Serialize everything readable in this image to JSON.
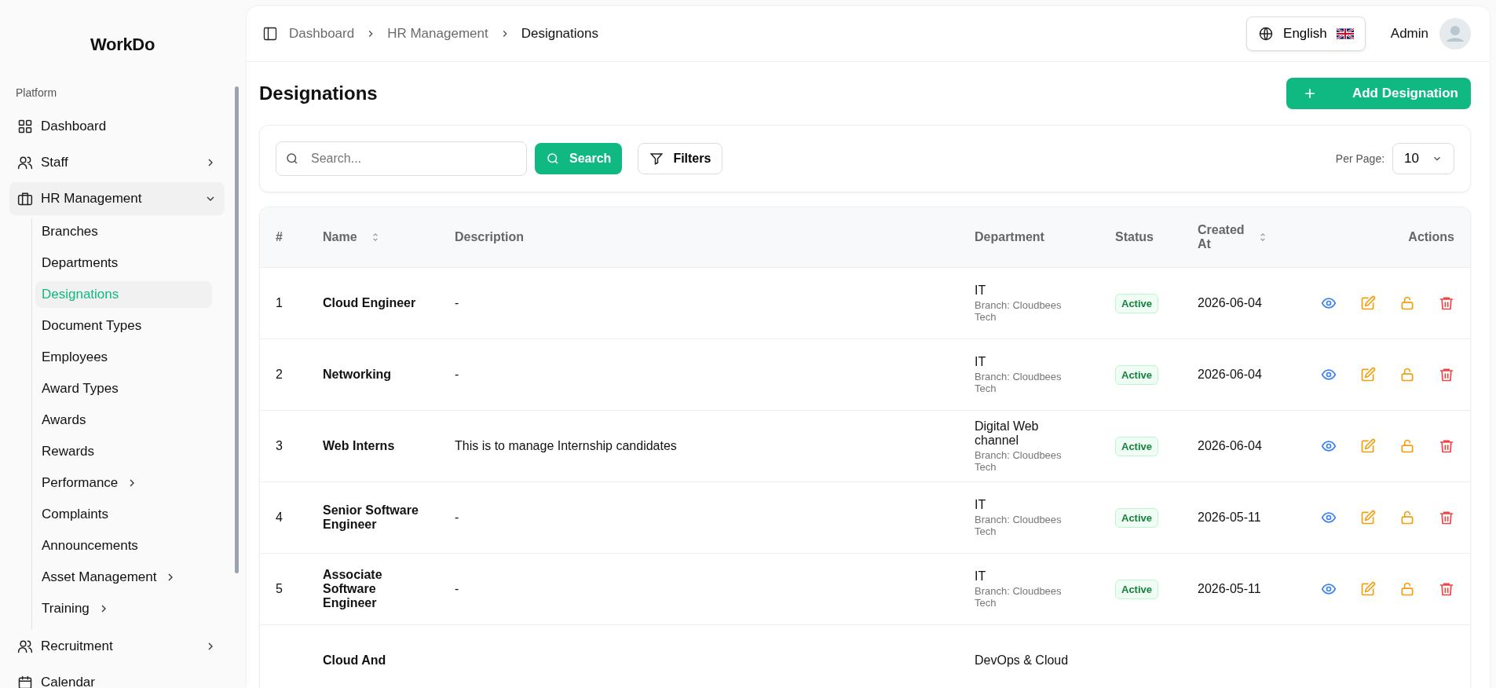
{
  "sidebar": {
    "brand": "WorkDo",
    "section": "Platform",
    "items": [
      {
        "label": "Dashboard",
        "selected": false
      },
      {
        "label": "Staff",
        "selected": false,
        "expanded": false
      },
      {
        "label": "HR Management",
        "selected": false,
        "expanded": true,
        "children": [
          {
            "label": "Branches",
            "selected": false
          },
          {
            "label": "Departments",
            "selected": false
          },
          {
            "label": "Designations",
            "selected": true
          },
          {
            "label": "Document Types",
            "selected": false
          },
          {
            "label": "Employees",
            "selected": false
          },
          {
            "label": "Award Types",
            "selected": false
          },
          {
            "label": "Awards",
            "selected": false
          },
          {
            "label": "Rewards",
            "selected": false
          },
          {
            "label": "Performance",
            "selected": false,
            "expanded": false
          },
          {
            "label": "Complaints",
            "selected": false
          },
          {
            "label": "Announcements",
            "selected": false
          },
          {
            "label": "Asset Management",
            "selected": false,
            "expanded": false
          },
          {
            "label": "Training",
            "selected": false,
            "expanded": false
          }
        ]
      },
      {
        "label": "Recruitment",
        "selected": false,
        "expanded": false
      },
      {
        "label": "Calendar",
        "selected": false
      }
    ]
  },
  "breadcrumb": [
    {
      "label": "Dashboard",
      "current": false
    },
    {
      "label": "HR Management",
      "current": false
    },
    {
      "label": "Designations",
      "current": true
    }
  ],
  "header": {
    "language": "English",
    "user": "Admin"
  },
  "page": {
    "title": "Designations",
    "add_button": "Add Designation"
  },
  "filters": {
    "placeholder": "Search...",
    "search_button": "Search",
    "filters_button": "Filters",
    "per_page_label": "Per Page:",
    "per_page": "10"
  },
  "table": {
    "columns": [
      {
        "label": "#",
        "sortable": false
      },
      {
        "label": "Name",
        "sortable": true
      },
      {
        "label": "Description",
        "sortable": false
      },
      {
        "label": "Department",
        "sortable": false
      },
      {
        "label": "Status",
        "sortable": false
      },
      {
        "label": "Created At",
        "sortable": true
      },
      {
        "label": "Actions",
        "sortable": false
      }
    ],
    "rows": [
      {
        "num": "1",
        "name": "Cloud Engineer",
        "description": "-",
        "department": "IT",
        "branch": "Branch: Cloudbees Tech",
        "status": "Active",
        "created": "2026-06-04"
      },
      {
        "num": "2",
        "name": "Networking",
        "description": "-",
        "department": "IT",
        "branch": "Branch: Cloudbees Tech",
        "status": "Active",
        "created": "2026-06-04"
      },
      {
        "num": "3",
        "name": "Web Interns",
        "description": "This is to manage Internship candidates",
        "department": "Digital Web channel",
        "branch": "Branch: Cloudbees Tech",
        "status": "Active",
        "created": "2026-06-04"
      },
      {
        "num": "4",
        "name": "Senior Software Engineer",
        "description": "-",
        "department": "IT",
        "branch": "Branch: Cloudbees Tech",
        "status": "Active",
        "created": "2026-05-11"
      },
      {
        "num": "5",
        "name": "Associate Software Engineer",
        "description": "-",
        "department": "IT",
        "branch": "Branch: Cloudbees Tech",
        "status": "Active",
        "created": "2026-05-11"
      },
      {
        "name": "Cloud And",
        "department": "DevOps & Cloud"
      }
    ]
  }
}
